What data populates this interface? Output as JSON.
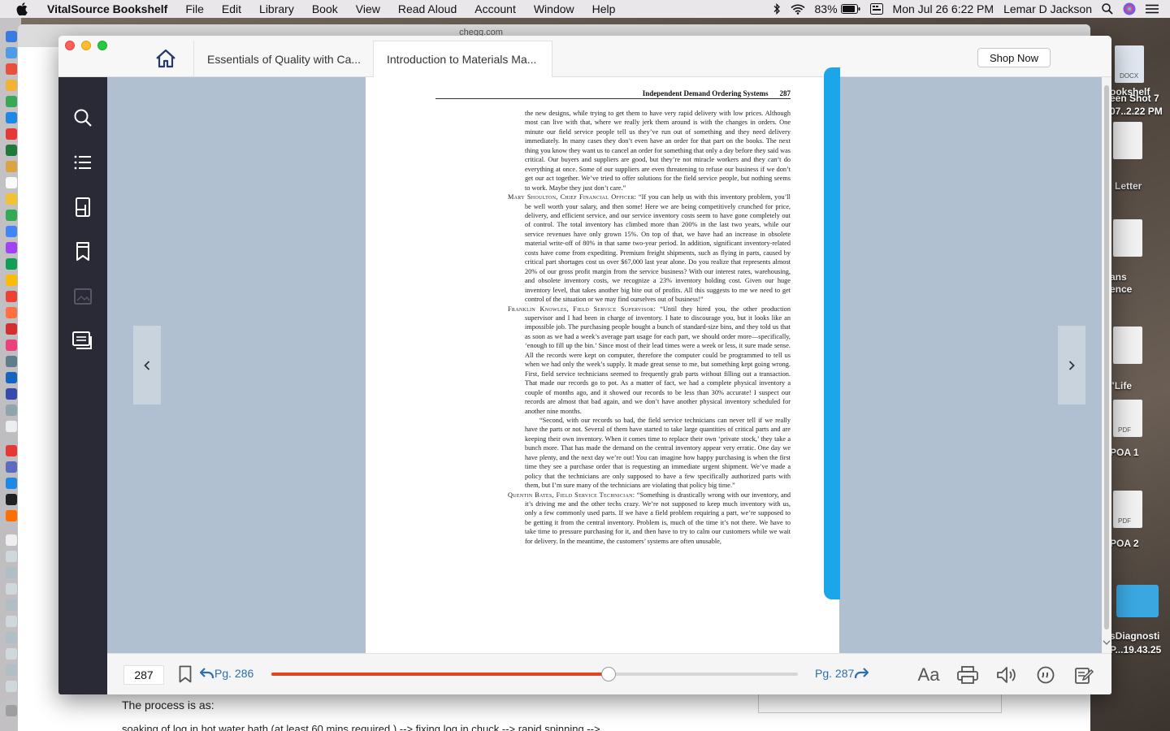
{
  "menubar": {
    "app_name": "VitalSource Bookshelf",
    "menus": [
      "File",
      "Edit",
      "Library",
      "Book",
      "View",
      "Read Aloud",
      "Account",
      "Window",
      "Help"
    ],
    "battery": "83%",
    "datetime": "Mon Jul 26  6:22 PM",
    "user": "Lemar D Jackson"
  },
  "desktop": {
    "files": [
      {
        "label": "DOCX",
        "type": "icon"
      },
      {
        "label": "ookshelf",
        "type": "text"
      },
      {
        "label": "een Shot 7",
        "type": "text"
      },
      {
        "label": "07..2.22 PM",
        "type": "text"
      },
      {
        "label": "Letter",
        "type": "text"
      },
      {
        "label": "ans",
        "type": "text"
      },
      {
        "label": "ence",
        "type": "text"
      },
      {
        "label": "\"Life",
        "type": "text"
      },
      {
        "label": "POA 1",
        "type": "text"
      },
      {
        "label": "POA 2",
        "type": "text"
      },
      {
        "label": "sDiagnosti",
        "type": "text"
      },
      {
        "label": "P...19.43.25",
        "type": "text"
      }
    ]
  },
  "browser": {
    "url": "chegg.com",
    "text1": "The process is as:",
    "text2": "soaking of log in hot water bath (at least 60 mins required ) --> fixing log in chuck --> rapid spinning -->"
  },
  "window": {
    "tabs": [
      {
        "label": "Essentials of Quality with Ca...",
        "active": false
      },
      {
        "label": "Introduction to Materials Ma...",
        "active": true
      }
    ],
    "shop_label": "Shop Now"
  },
  "sidebar": {
    "items": [
      "search",
      "table-of-contents",
      "flashcards",
      "bookmarks",
      "figures",
      "notes"
    ]
  },
  "page": {
    "running_head": "Independent Demand Ordering Systems",
    "page_number": "287",
    "paragraphs": [
      {
        "speaker": "",
        "style": "cont",
        "text": "the new designs, while trying to get them to have very rapid delivery with low prices. Although most can live with that, where we really jerk them around is with the changes in orders. One minute our field service people tell us they’ve run out of something and they need delivery immediately. In many cases they don’t even have an order for that part on the books. The next thing you know they want us to cancel an order for something that only a day before they said was critical. Our buyers and suppliers are good, but they’re not miracle workers and they can’t do everything at once. Some of our suppliers are even threatening to refuse our business if we don’t get our act together. We’ve tried to offer solutions for the field service people, but nothing seems to work. Maybe they just don’t care.”"
      },
      {
        "speaker": "Mary Shoulton, Chief Financial Officer:",
        "style": "sp",
        "text": " “If you can help us with this inventory problem, you’ll be well worth your salary, and then some! Here we are being competitively crunched for price, delivery, and efficient service, and our service inventory costs seem to have gone completely out of control. The total inventory has climbed more than 200% in the last two years, while our service revenues have only grown 15%. On top of that, we have had an increase in obsolete material write-off of 80% in that same two-year period. In addition, significant inventory-related costs have come from expediting. Premium freight shipments, such as flying in parts, caused by critical part shortages cost us over $67,000 last year alone. Do you realize that represents almost 20% of our gross profit margin from the service business? With our interest rates, warehousing, and obsolete inventory costs, we recognize a 23% inventory holding cost. Given our huge inventory level, that takes another big bite out of profits. All this suggests to me we need to get control of the situation or we may find ourselves out of business!”"
      },
      {
        "speaker": "Franklin Knowles, Field Service Supervisor:",
        "style": "sp",
        "text": " “Until they hired you, the other production supervisor and I had been in charge of inventory. I hate to discourage you, but it looks like an impossible job. The purchasing people bought a bunch of standard-size bins, and they told us that as soon as we had a week’s average part usage for each part, we should order more—specifically, ‘enough to fill up the bin.’ Since most of their lead times were a week or less, it sure made sense. All the records were kept on computer, therefore the computer could be programmed to tell us when we had only the week’s supply. It made great sense to me, but something kept going wrong. First, field service technicians seemed to frequently grab parts without filling out a transaction. That made our records go to pot. As a matter of fact, we had a complete physical inventory a couple of months ago, and it showed our records to be less than 30% accurate! I suspect our records are almost that bad again, and we don’t have another physical inventory scheduled for another nine months."
      },
      {
        "speaker": "",
        "style": "ind",
        "text": "“Second, with our records so bad, the field service technicians can never tell if we really have the parts or not. Several of them have started to take large quantities of critical parts and are keeping their own inventory. When it comes time to replace their own ‘private stock,’ they take a bunch more. That has made the demand on the central inventory appear very erratic. One day we have plenty, and the next day we’re out! You can imagine how happy purchasing is when the first time they see a purchase order that is requesting an immediate urgent shipment. We’ve made a policy that the technicians are only supposed to have a few specifically authorized parts with them, but I’m sure many of the technicians are violating that policy big time.”"
      },
      {
        "speaker": "Quentin Bates, Field Service Technician:",
        "style": "sp",
        "text": " “Something is drastically wrong with our inventory, and it’s driving me and the other techs crazy. We’re not supposed to keep much inventory with us, only a few commonly used parts. If we have a field problem requiring a part, we’re supposed to be getting it from the central inventory. Problem is, much of the time it’s not there. We have to take time to pressure purchasing for it, and then have to try to calm our customers while we wait for delivery. In the meantime, the customers’ systems are often unusable,"
      }
    ]
  },
  "bottombar": {
    "current_page": "287",
    "back_label": "Pg. 286",
    "forward_label": "Pg. 287",
    "progress": 0.64,
    "font_label": "Aa"
  },
  "colors": {
    "sidebar_bg": "#2a2a36",
    "stage_bg": "#b1c0d1",
    "highlight": "#1aa6e8",
    "progress": "#e0461c",
    "link": "#2a6fb0"
  }
}
